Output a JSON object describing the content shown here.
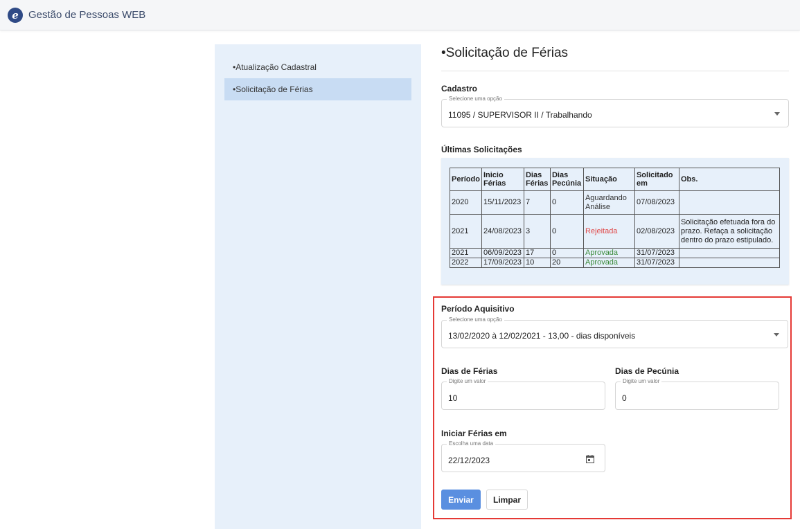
{
  "app": {
    "logo_letter": "e",
    "title": "Gestão de Pessoas WEB"
  },
  "sidebar": {
    "items": [
      {
        "label": "•Atualização Cadastral",
        "active": false
      },
      {
        "label": "•Solicitação de Férias",
        "active": true
      }
    ]
  },
  "page": {
    "title": "•Solicitação de Férias"
  },
  "cadastro": {
    "label": "Cadastro",
    "legend": "Selecione uma opção",
    "value": "11095 / SUPERVISOR II / Trabalhando"
  },
  "ultimas": {
    "label": "Últimas Solicitações",
    "columns": [
      "Período",
      "Inicio Férias",
      "Dias Férias",
      "Dias Pecúnia",
      "Situação",
      "Solicitado em",
      "Obs."
    ],
    "rows": [
      {
        "periodo": "2020",
        "inicio": "15/11/2023",
        "dias_ferias": "7",
        "dias_pecunia": "0",
        "situacao": "Aguardando Análise",
        "status": "pending",
        "solicitado": "07/08/2023",
        "obs": ""
      },
      {
        "periodo": "2021",
        "inicio": "24/08/2023",
        "dias_ferias": "3",
        "dias_pecunia": "0",
        "situacao": "Rejeitada",
        "status": "rejected",
        "solicitado": "02/08/2023",
        "obs": "Solicitação efetuada fora do prazo. Refaça a solicitação dentro do prazo estipulado."
      },
      {
        "periodo": "2021",
        "inicio": "06/09/2023",
        "dias_ferias": "17",
        "dias_pecunia": "0",
        "situacao": "Aprovada",
        "status": "approved",
        "solicitado": "31/07/2023",
        "obs": ""
      },
      {
        "periodo": "2022",
        "inicio": "17/09/2023",
        "dias_ferias": "10",
        "dias_pecunia": "20",
        "situacao": "Aprovada",
        "status": "approved",
        "solicitado": "31/07/2023",
        "obs": ""
      }
    ]
  },
  "periodo": {
    "label": "Período Aquisitivo",
    "legend": "Selecione uma opção",
    "value": "13/02/2020 à 12/02/2021 - 13,00 - dias disponíveis"
  },
  "dias_ferias": {
    "label": "Dias de Férias",
    "legend": "Digite um valor",
    "value": "10"
  },
  "dias_pecunia": {
    "label": "Dias de Pecúnia",
    "legend": "Digite um valor",
    "value": "0"
  },
  "iniciar": {
    "label": "Iniciar Férias em",
    "legend": "Escolha uma data",
    "value": "22/12/2023"
  },
  "actions": {
    "submit": "Enviar",
    "clear": "Limpar"
  },
  "colors": {
    "accent": "#5a8fe0",
    "highlight": "#e53935",
    "rejected": "#e04a4a",
    "approved": "#3a8a3a"
  }
}
